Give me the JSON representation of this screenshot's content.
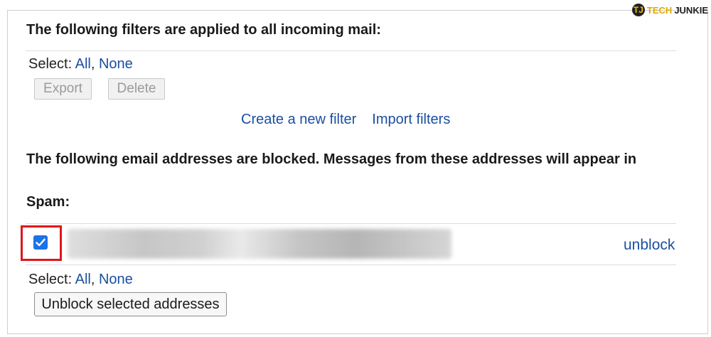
{
  "logo": {
    "mark": "TJ",
    "tech": "TECH",
    "junkie": "JUNKIE"
  },
  "filters": {
    "heading": "The following filters are applied to all incoming mail:",
    "select_label": "Select:",
    "select_all": "All",
    "select_none": "None",
    "export_label": "Export",
    "delete_label": "Delete",
    "create_filter_label": "Create a new filter",
    "import_filters_label": "Import filters"
  },
  "blocked": {
    "heading_line1": "The following email addresses are blocked. Messages from these addresses will appear in",
    "heading_line2": "Spam:",
    "row": {
      "checked": true,
      "unblock_label": "unblock"
    },
    "select_label": "Select:",
    "select_all": "All",
    "select_none": "None",
    "unblock_selected_label": "Unblock selected addresses"
  },
  "colors": {
    "link": "#1a4fa0",
    "highlight": "#e0151c",
    "checkbox": "#1a73e8"
  }
}
